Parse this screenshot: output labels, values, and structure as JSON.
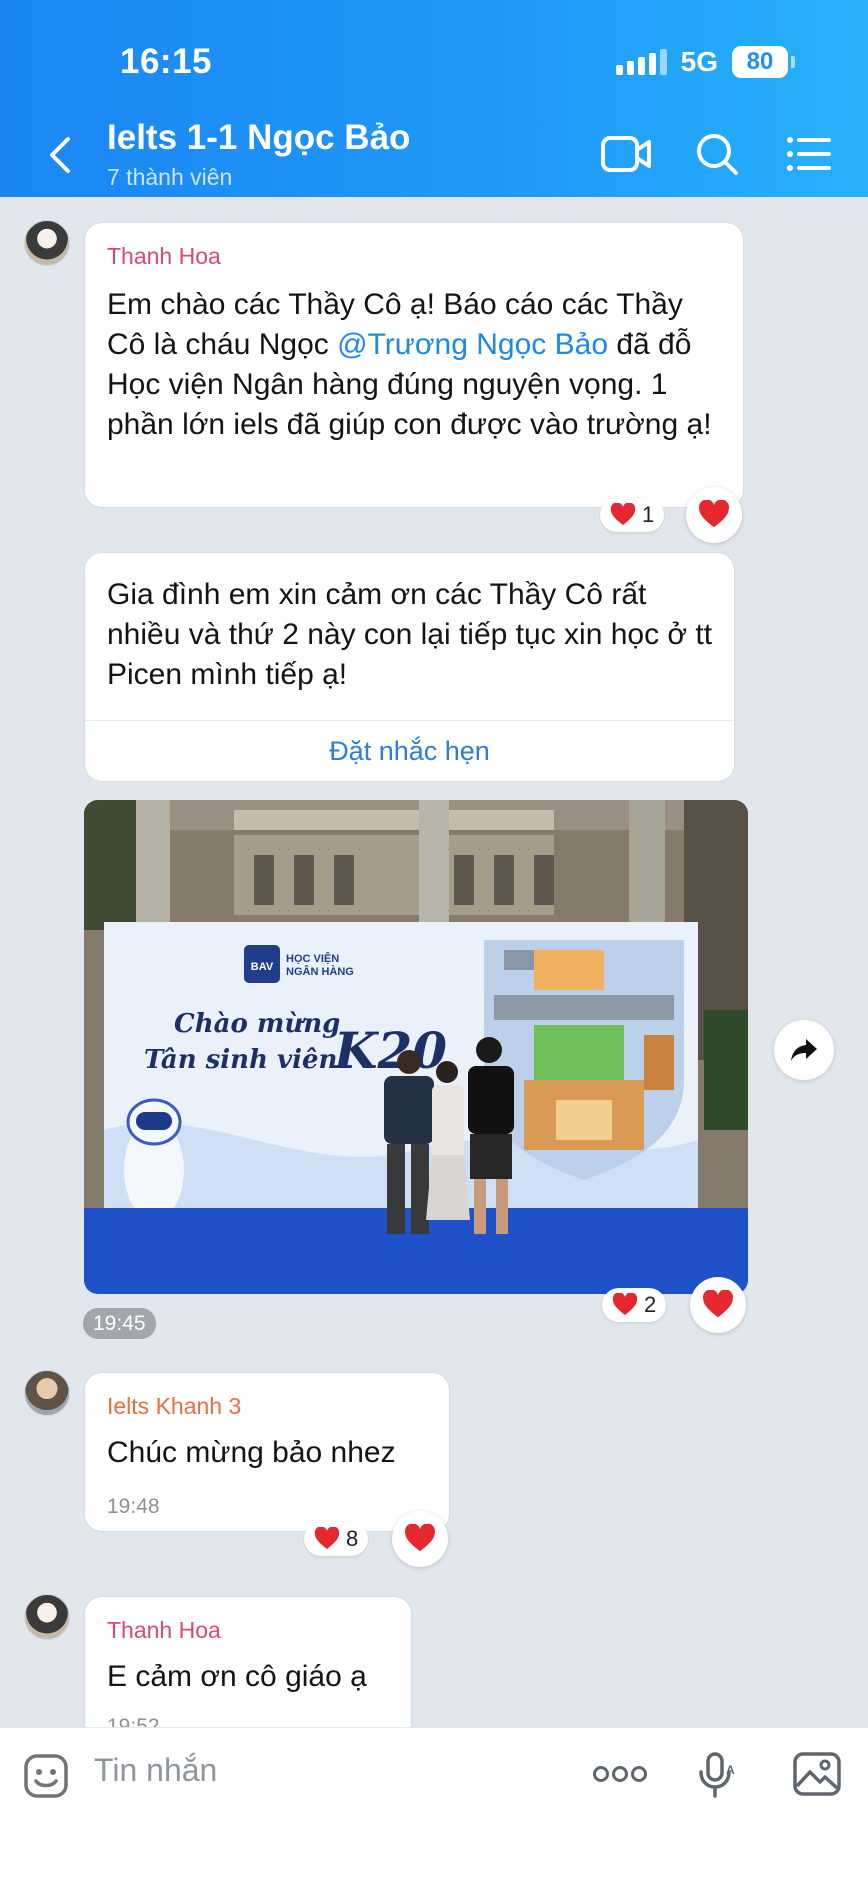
{
  "status_bar": {
    "time": "16:15",
    "network": "5G",
    "battery": "80"
  },
  "header": {
    "title": "Ielts 1-1 Ngọc Bảo",
    "subtitle": "7 thành viên"
  },
  "messages": [
    {
      "sender": "Thanh Hoa",
      "text_before": "Em chào các Thầy Cô ạ! Báo cáo các Thầy Cô là cháu Ngọc ",
      "mention": "@Trương Ngọc Bảo",
      "text_after": " đã đỗ Học viện Ngân hàng đúng nguyện vọng. 1 phần lớn iels đã giúp con được vào trường ạ!",
      "reaction_count": "1"
    },
    {
      "text": "Gia đình em xin cảm ơn các Thầy Cô rất nhiều và thứ 2 này con lại tiếp tục xin học ở tt Picen mình tiếp ạ!",
      "action_label": "Đặt nhắc hẹn"
    },
    {
      "photo": {
        "banner_logo": "BAV",
        "banner_org_line1": "HỌC VIỆN",
        "banner_org_line2": "NGÂN HÀNG",
        "banner_line1": "Chào mừng",
        "banner_line2": "Tân sinh viên",
        "banner_k": "K20"
      },
      "time": "19:45",
      "reaction_count": "2"
    },
    {
      "sender": "Ielts Khanh 3",
      "text": "Chúc mừng bảo nhez",
      "time": "19:48",
      "reaction_count": "8"
    },
    {
      "sender": "Thanh Hoa",
      "text": "E cảm ơn cô giáo ạ",
      "time": "19:52"
    }
  ],
  "input": {
    "placeholder": "Tin nhắn"
  },
  "colors": {
    "header_start": "#1b86f3",
    "header_end": "#27b2fb",
    "mention": "#1e88e5",
    "heart": "#e5282f"
  },
  "icons": [
    "back-icon",
    "video-call-icon",
    "search-icon",
    "menu-icon",
    "heart-icon",
    "share-icon",
    "sticker-icon",
    "more-icon",
    "voice-icon",
    "image-icon"
  ]
}
